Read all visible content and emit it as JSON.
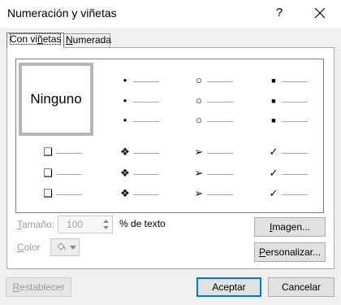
{
  "dialog": {
    "title": "Numeración y viñetas",
    "help_label": "?",
    "close_icon": "close-icon"
  },
  "tabs": [
    {
      "label_pre": "Con vi",
      "label_u": "ñ",
      "label_post": "etas",
      "active": true
    },
    {
      "label_pre": "",
      "label_u": "N",
      "label_post": "umerada",
      "active": false
    }
  ],
  "gallery": {
    "none_label": "Ninguno",
    "bullet_styles": [
      {
        "icon": "filled-dot-icon",
        "glyph": "•"
      },
      {
        "icon": "hollow-circle-icon",
        "glyph": "○"
      },
      {
        "icon": "filled-square-icon",
        "glyph": "■"
      },
      {
        "icon": "shadowed-box-icon",
        "glyph": "❑"
      },
      {
        "icon": "four-diamond-icon",
        "glyph": "❖"
      },
      {
        "icon": "arrowhead-icon",
        "glyph": "➢"
      },
      {
        "icon": "checkmark-icon",
        "glyph": "✓"
      }
    ]
  },
  "size": {
    "label_u": "T",
    "label_post": "amaño:",
    "value": "100",
    "unit": "% de texto"
  },
  "color": {
    "label_u": "C",
    "label_post": "olor"
  },
  "buttons": {
    "image_pre": "",
    "image_u": "I",
    "image_post": "magen...",
    "custom_pre": "",
    "custom_u": "P",
    "custom_post": "ersonalizar...",
    "reset_pre": "",
    "reset_u": "R",
    "reset_post": "establecer",
    "accept": "Aceptar",
    "cancel": "Cancelar"
  },
  "colors": {
    "accent": "#0078d7",
    "selected_border": "#b6b6b6",
    "disabled_text": "#9a9a9a"
  }
}
